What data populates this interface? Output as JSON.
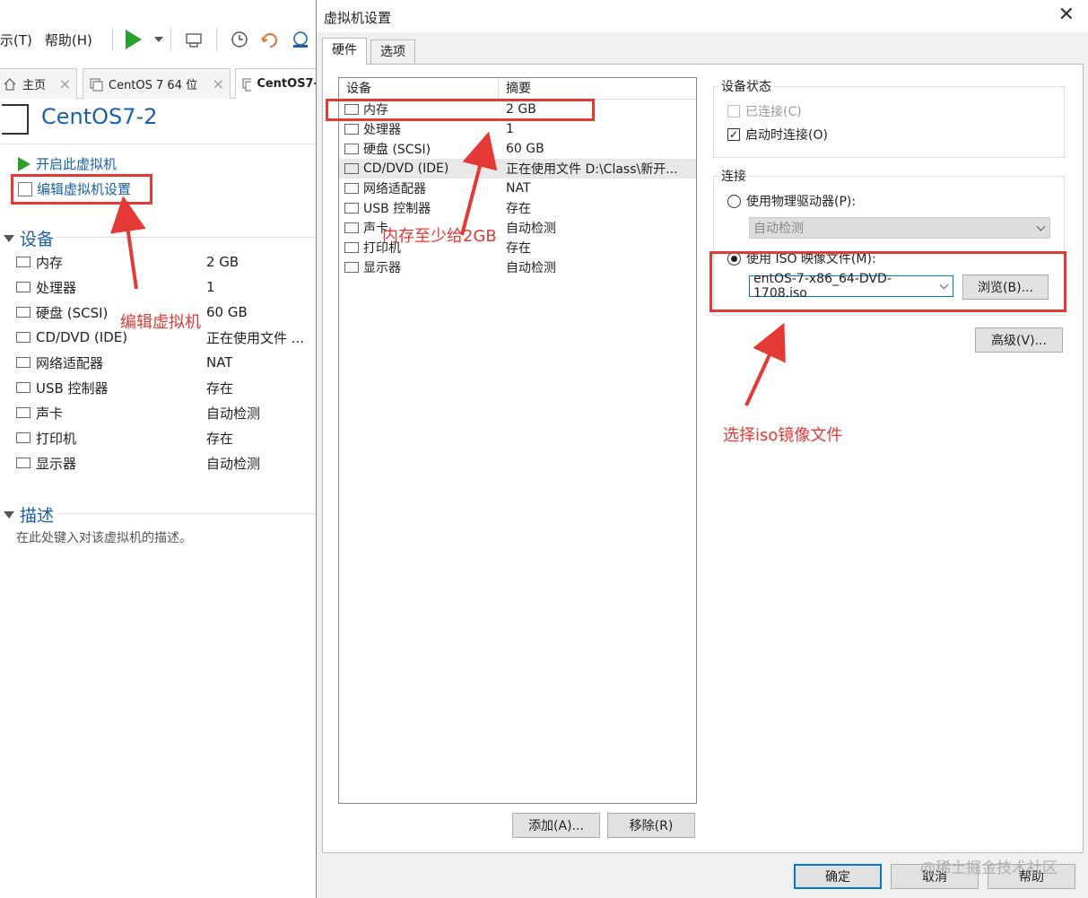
{
  "menu": {
    "view_partial": "示(T)",
    "help": "帮助(H)"
  },
  "tabs": {
    "home": "主页",
    "centos764": "CentOS 7 64 位",
    "centos72": "CentOS7-"
  },
  "vm": {
    "title": "CentOS7-2",
    "start_cmd": "开启此虚拟机",
    "edit_cmd": "编辑虚拟机设置",
    "devices_heading": "设备",
    "devices": [
      {
        "name": "内存",
        "value": "2 GB",
        "icon": "memory-icon"
      },
      {
        "name": "处理器",
        "value": "1",
        "icon": "cpu-icon"
      },
      {
        "name": "硬盘 (SCSI)",
        "value": "60 GB",
        "icon": "disk-icon"
      },
      {
        "name": "CD/DVD (IDE)",
        "value": "正在使用文件 ...",
        "icon": "cd-icon"
      },
      {
        "name": "网络适配器",
        "value": "NAT",
        "icon": "network-icon"
      },
      {
        "name": "USB 控制器",
        "value": "存在",
        "icon": "usb-icon"
      },
      {
        "name": "声卡",
        "value": "自动检测",
        "icon": "sound-icon"
      },
      {
        "name": "打印机",
        "value": "存在",
        "icon": "printer-icon"
      },
      {
        "name": "显示器",
        "value": "自动检测",
        "icon": "display-icon"
      }
    ],
    "desc_heading": "描述",
    "desc_placeholder": "在此处键入对该虚拟机的描述。"
  },
  "dialog": {
    "title": "虚拟机设置",
    "tab_hardware": "硬件",
    "tab_options": "选项",
    "col_device": "设备",
    "col_summary": "摘要",
    "rows": [
      {
        "name": "内存",
        "value": "2 GB"
      },
      {
        "name": "处理器",
        "value": "1"
      },
      {
        "name": "硬盘 (SCSI)",
        "value": "60 GB"
      },
      {
        "name": "CD/DVD (IDE)",
        "value": "正在使用文件 D:\\Class\\新开..."
      },
      {
        "name": "网络适配器",
        "value": "NAT"
      },
      {
        "name": "USB 控制器",
        "value": "存在"
      },
      {
        "name": "声卡",
        "value": "自动检测"
      },
      {
        "name": "打印机",
        "value": "存在"
      },
      {
        "name": "显示器",
        "value": "自动检测"
      }
    ],
    "add_btn": "添加(A)...",
    "remove_btn": "移除(R)",
    "device_status_label": "设备状态",
    "connected_label": "已连接(C)",
    "connect_on_start_label": "启动时连接(O)",
    "connect_on_start_checked": true,
    "connection_label": "连接",
    "use_physical_label": "使用物理驱动器(P):",
    "physical_select_value": "自动检测",
    "use_iso_label": "使用 ISO 映像文件(M):",
    "iso_value": "entOS-7-x86_64-DVD-1708.iso",
    "browse_btn": "浏览(B)...",
    "advanced_btn": "高级(V)...",
    "ok_btn": "确定",
    "cancel_btn": "取消",
    "help_btn": "帮助"
  },
  "annotations": {
    "edit_vm": "编辑虚拟机",
    "memory_hint": "内存至少给2GB",
    "iso_hint": "选择iso镜像文件",
    "color": "#e53935"
  },
  "watermark": "@稀土掘金技术社区"
}
